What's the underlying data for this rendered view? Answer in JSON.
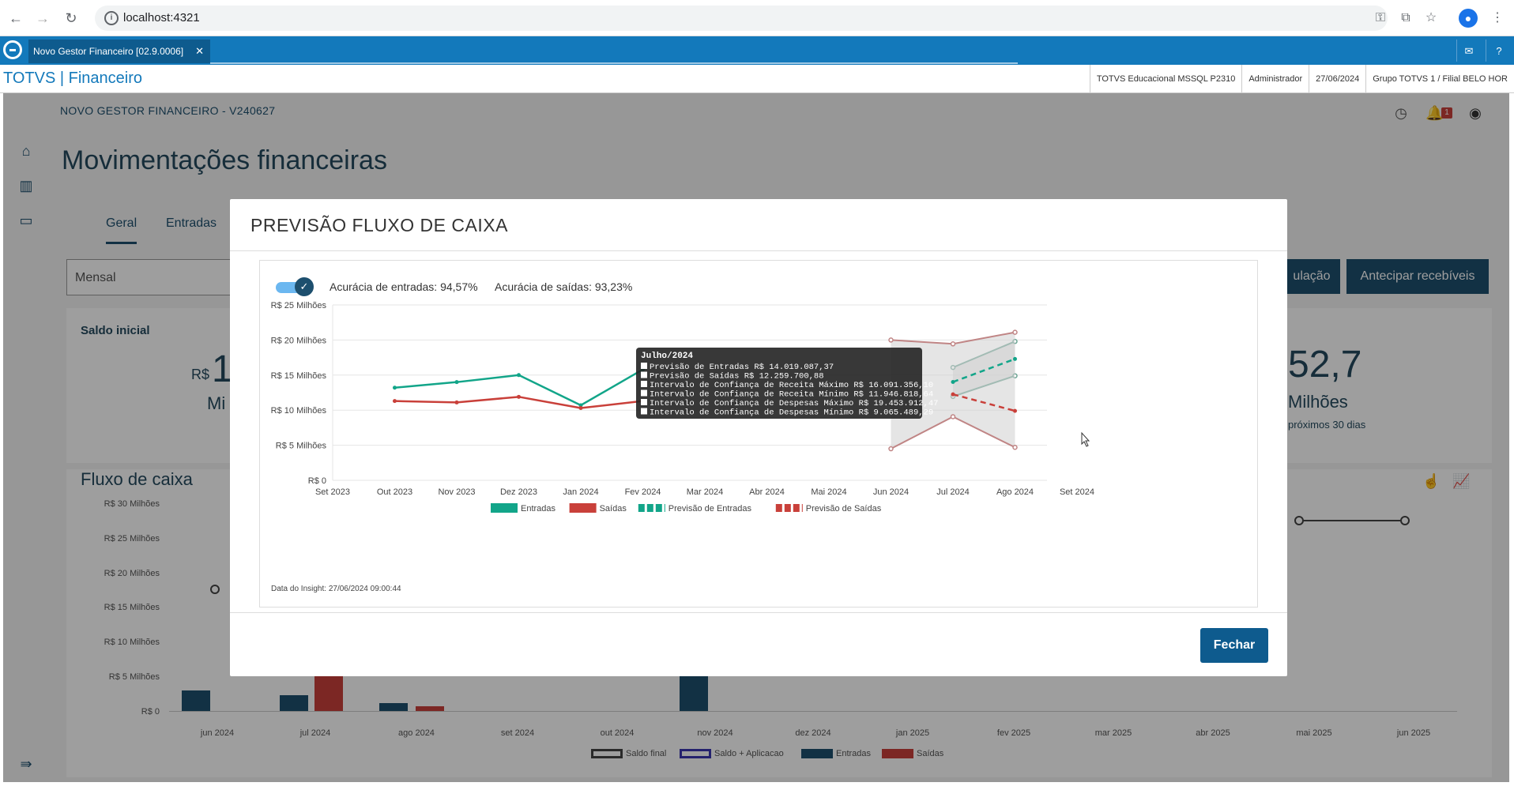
{
  "browser": {
    "url": "localhost:4321"
  },
  "tabstrip": {
    "active_tab": "Novo Gestor Financeiro [02.9.0006]"
  },
  "app_header": {
    "title": "TOTVS | Financeiro",
    "info": [
      "TOTVS Educacional MSSQL P2310",
      "Administrador",
      "27/06/2024",
      "Grupo TOTVS 1 / Filial BELO HOR"
    ]
  },
  "page": {
    "topline": "NOVO GESTOR FINANCEIRO - V240627",
    "title": "Movimentações financeiras",
    "tabs": [
      "Geral",
      "Entradas"
    ],
    "period_select": "Mensal",
    "buttons": [
      "ulação",
      "Antecipar recebíveis"
    ],
    "saldo_title": "Saldo inicial",
    "saldo_prefix": "R$",
    "saldo_value": "1",
    "saldo_unit": "Mi",
    "right_value": "52,7",
    "right_unit": "Milhões",
    "right_caption": "próximos 30 dias",
    "notif_count": "1",
    "cashflow": {
      "title": "Fluxo de caixa",
      "yticks": [
        "R$ 30 Milhões",
        "R$ 25 Milhões",
        "R$ 20 Milhões",
        "R$ 15 Milhões",
        "R$ 10 Milhões",
        "R$ 5 Milhões",
        "R$ 0"
      ],
      "xticks": [
        "jun 2024",
        "jul 2024",
        "ago 2024",
        "set 2024",
        "out 2024",
        "nov 2024",
        "dez 2024",
        "jan 2025",
        "fev 2025",
        "mar 2025",
        "abr 2025",
        "mai 2025",
        "jun 2025"
      ],
      "legend": [
        "Saldo final",
        "Saldo + Aplicacao",
        "Entradas",
        "Saídas"
      ]
    }
  },
  "modal": {
    "title": "PREVISÃO FLUXO DE CAIXA",
    "accuracy_in": "Acurácia de entradas: 94,57%",
    "accuracy_out": "Acurácia de saídas: 93,23%",
    "insight_date": "Data do Insight: 27/06/2024 09:00:44",
    "close_label": "Fechar",
    "tooltip": {
      "title": "Julho/2024",
      "lines": [
        "Previsão de Entradas R$ 14.019.087,37",
        "Previsão de Saídas R$ 12.259.700,88",
        "Intervalo de Confiança de Receita Máximo R$ 16.091.356,10",
        "Intervalo de Confiança de Receita Mínimo R$ 11.946.818,64",
        "Intervalo de Confiança de Despesas Máximo R$ 19.453.912,47",
        "Intervalo de Confiança de Despesas Mínimo R$ 9.065.489,29"
      ]
    }
  },
  "chart_data": {
    "type": "line",
    "x": [
      "Set 2023",
      "Out 2023",
      "Nov 2023",
      "Dez 2023",
      "Jan 2024",
      "Fev 2024",
      "Mar 2024",
      "Abr 2024",
      "Mai 2024",
      "Jun 2024",
      "Jul 2024",
      "Ago 2024",
      "Set 2024"
    ],
    "yticks": [
      "R$ 0",
      "R$ 5 Milhões",
      "R$ 10 Milhões",
      "R$ 15 Milhões",
      "R$ 20 Milhões",
      "R$ 25 Milhões"
    ],
    "ylim": [
      0,
      25
    ],
    "grid": true,
    "legend_position": "bottom",
    "series": [
      {
        "name": "Entradas",
        "color": "#12a589",
        "style": "solid",
        "values": [
          null,
          13.2,
          14.0,
          15.0,
          10.7,
          15.8,
          null,
          null,
          null,
          null,
          null,
          null,
          null
        ]
      },
      {
        "name": "Saídas",
        "color": "#c9403a",
        "style": "solid",
        "values": [
          null,
          11.3,
          11.1,
          11.9,
          10.3,
          11.3,
          null,
          null,
          null,
          null,
          null,
          null,
          null
        ]
      },
      {
        "name": "Previsão de Entradas",
        "color": "#12a589",
        "style": "dashed",
        "values": [
          null,
          null,
          null,
          null,
          null,
          null,
          null,
          null,
          null,
          null,
          14.02,
          17.3,
          null
        ]
      },
      {
        "name": "Previsão de Saídas",
        "color": "#c9403a",
        "style": "dashed",
        "values": [
          null,
          null,
          null,
          null,
          null,
          null,
          null,
          null,
          null,
          null,
          12.26,
          9.9,
          null
        ]
      }
    ],
    "bands": [
      {
        "name": "Intervalo de Confiança de Receita",
        "color": "#12a589",
        "max": [
          null,
          null,
          null,
          null,
          null,
          null,
          null,
          null,
          null,
          null,
          16.09,
          19.8,
          null
        ],
        "min": [
          null,
          null,
          null,
          null,
          null,
          null,
          null,
          null,
          null,
          null,
          11.95,
          14.9,
          null
        ]
      },
      {
        "name": "Intervalo de Confiança de Despesas",
        "color": "#c9403a",
        "max": [
          null,
          null,
          null,
          null,
          null,
          null,
          null,
          null,
          null,
          20.0,
          19.45,
          21.1,
          null
        ],
        "min": [
          null,
          null,
          null,
          null,
          null,
          null,
          null,
          null,
          null,
          4.5,
          9.07,
          4.7,
          null
        ]
      }
    ]
  }
}
